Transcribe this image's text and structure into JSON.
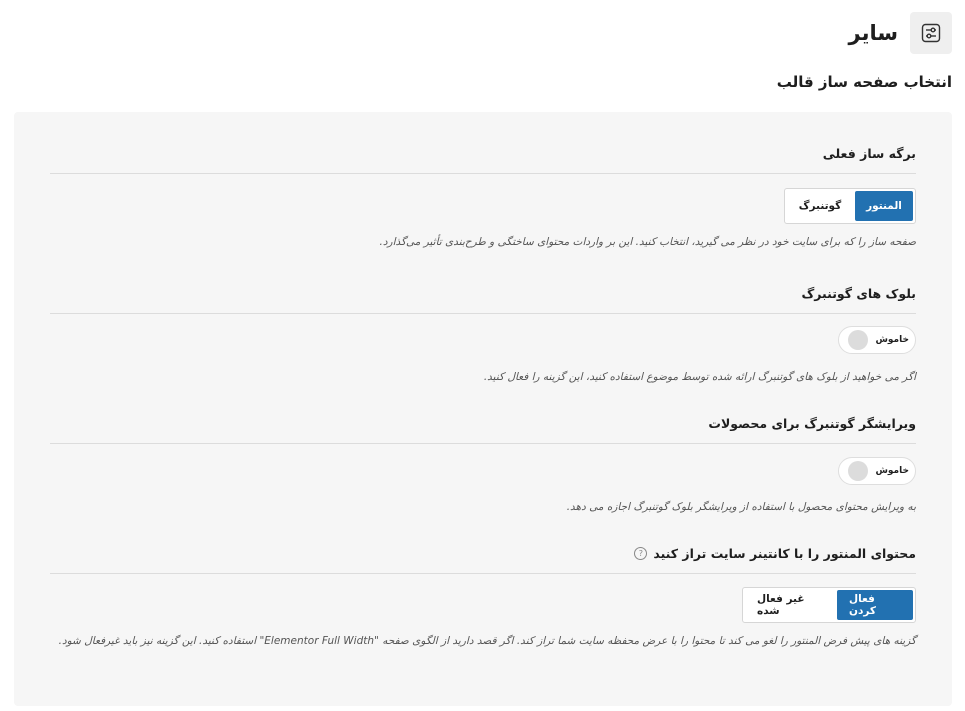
{
  "header": {
    "title": "سایر",
    "icon": "sliders-icon"
  },
  "section_title": "انتخاب صفحه ساز قالب",
  "fields": {
    "page_builder": {
      "label": "برگه ساز فعلی",
      "options": [
        "المنتور",
        "گوتنبرگ"
      ],
      "selected": "المنتور",
      "description": "صفحه ساز را که برای سایت خود در نظر می گیرید، انتخاب کنید. این بر واردات محتوای ساختگی و طرح‌بندی تأثیر می‌گذارد."
    },
    "gutenberg_blocks": {
      "label": "بلوک های گوتنبرگ",
      "toggle_text": "خاموش",
      "state": "off",
      "description": "اگر می خواهید از بلوک های گوتنبرگ ارائه شده توسط موضوع استفاده کنید، این گزینه را فعال کنید."
    },
    "gutenberg_products": {
      "label": "ویرایشگر گوتنبرگ برای محصولات",
      "toggle_text": "خاموش",
      "state": "off",
      "description": "به ویرایش محتوای محصول با استفاده از ویرایشگر بلوک گوتنبرگ اجازه می دهد."
    },
    "elementor_container": {
      "label": "محتوای المنتور را با کانتینر سایت تراز کنید",
      "help": "?",
      "options": [
        "فعال کردن",
        "غیر فعال شده"
      ],
      "selected": "فعال کردن",
      "description": "گزینه های پیش فرض المنتور را لغو می کند تا محتوا را با عرض محفظه سایت شما تراز کند. اگر قصد دارید از الگوی صفحه \"Elementor Full Width\" استفاده کنید. این گزینه نیز باید غیرفعال شود."
    }
  },
  "colors": {
    "accent": "#2271b1",
    "panel_bg": "#f6f6f6"
  }
}
